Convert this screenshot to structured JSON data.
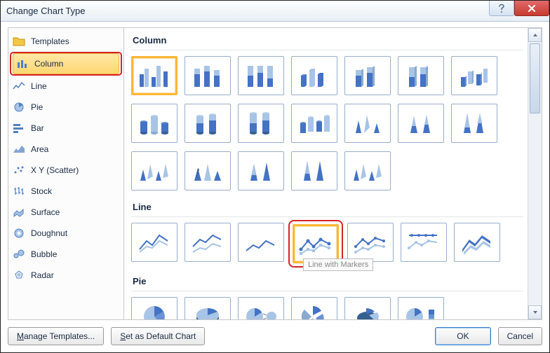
{
  "dialog": {
    "title": "Change Chart Type"
  },
  "sidebar": {
    "items": [
      {
        "label": "Templates",
        "icon": "folder-icon"
      },
      {
        "label": "Column",
        "icon": "column-icon",
        "selected": true
      },
      {
        "label": "Line",
        "icon": "line-icon"
      },
      {
        "label": "Pie",
        "icon": "pie-icon"
      },
      {
        "label": "Bar",
        "icon": "bar-icon"
      },
      {
        "label": "Area",
        "icon": "area-icon"
      },
      {
        "label": "X Y (Scatter)",
        "icon": "scatter-icon"
      },
      {
        "label": "Stock",
        "icon": "stock-icon"
      },
      {
        "label": "Surface",
        "icon": "surface-icon"
      },
      {
        "label": "Doughnut",
        "icon": "doughnut-icon"
      },
      {
        "label": "Bubble",
        "icon": "bubble-icon"
      },
      {
        "label": "Radar",
        "icon": "radar-icon"
      }
    ]
  },
  "sections": {
    "column": {
      "heading": "Column"
    },
    "line": {
      "heading": "Line"
    },
    "pie": {
      "heading": "Pie"
    }
  },
  "tooltip": {
    "line_markers": "Line with Markers"
  },
  "buttons": {
    "manage_templates": "Manage Templates...",
    "set_default": "Set as Default Chart",
    "ok": "OK",
    "cancel": "Cancel"
  },
  "colors": {
    "accent": "#4472c4",
    "accent_dark": "#365f91",
    "highlight_red": "#d62424",
    "select_orange": "#ffb735"
  }
}
